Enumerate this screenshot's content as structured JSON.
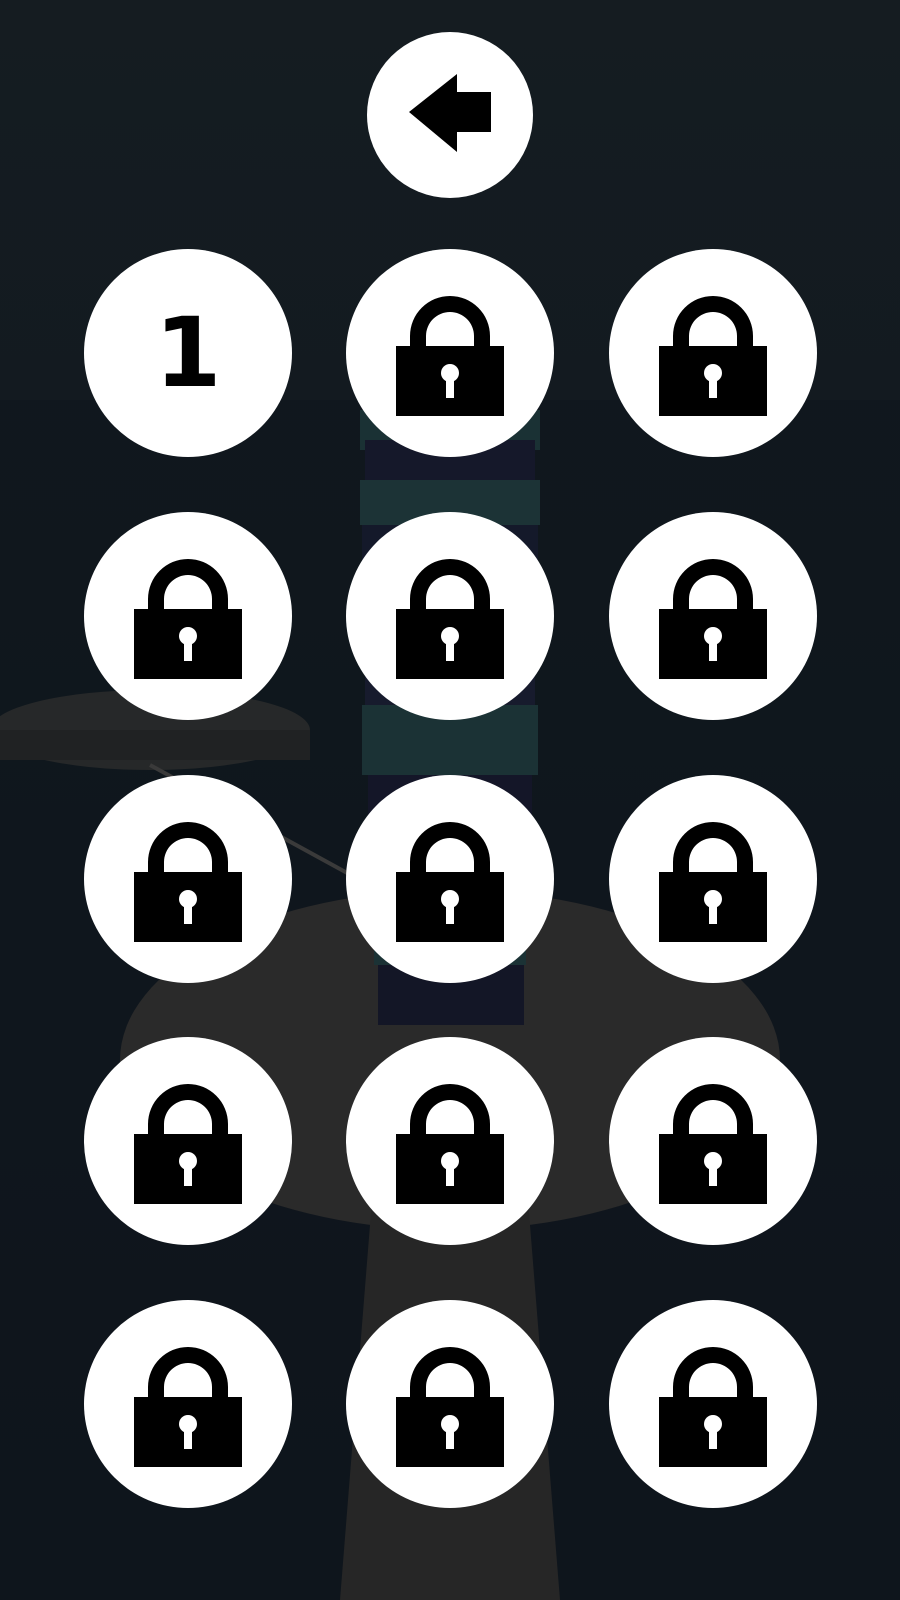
{
  "back_button": {
    "icon": "arrow-left-icon"
  },
  "levels": [
    {
      "label": "1",
      "locked": false
    },
    {
      "label": "",
      "locked": true
    },
    {
      "label": "",
      "locked": true
    },
    {
      "label": "",
      "locked": true
    },
    {
      "label": "",
      "locked": true
    },
    {
      "label": "",
      "locked": true
    },
    {
      "label": "",
      "locked": true
    },
    {
      "label": "",
      "locked": true
    },
    {
      "label": "",
      "locked": true
    },
    {
      "label": "",
      "locked": true
    },
    {
      "label": "",
      "locked": true
    },
    {
      "label": "",
      "locked": true
    },
    {
      "label": "",
      "locked": true
    },
    {
      "label": "",
      "locked": true
    },
    {
      "label": "",
      "locked": true
    }
  ],
  "colors": {
    "button": "#ffffff",
    "icon": "#000000",
    "background": "#131b22"
  }
}
